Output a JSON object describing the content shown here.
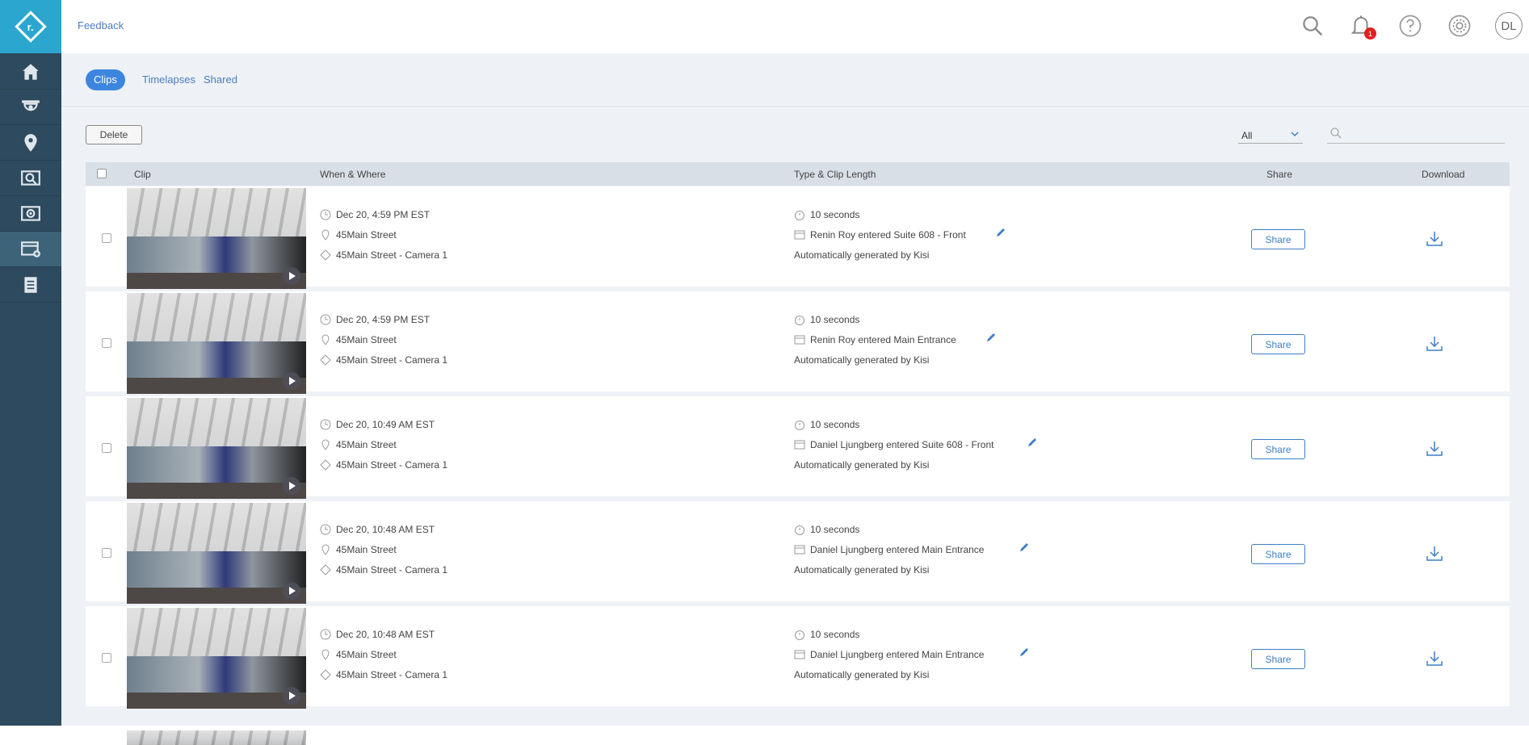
{
  "app": {
    "logo_letter": "r.",
    "feedback_label": "Feedback",
    "notification_count": "1",
    "avatar_initials": "DL"
  },
  "sidebar": {
    "items": [
      {
        "name": "home-icon"
      },
      {
        "name": "camera-icon"
      },
      {
        "name": "location-pin-icon"
      },
      {
        "name": "search-video-icon"
      },
      {
        "name": "video-wall-icon"
      },
      {
        "name": "clips-icon",
        "active": true
      },
      {
        "name": "reports-icon"
      }
    ]
  },
  "tabs": [
    {
      "label": "Clips",
      "active": true
    },
    {
      "label": "Timelapses"
    },
    {
      "label": "Shared"
    }
  ],
  "toolbar": {
    "delete_label": "Delete",
    "filter_value": "All",
    "search_placeholder": ""
  },
  "table": {
    "headers": {
      "clip": "Clip",
      "when_where": "When & Where",
      "type_length": "Type & Clip Length",
      "share": "Share",
      "download": "Download"
    },
    "share_label": "Share",
    "rows": [
      {
        "datetime": "Dec 20, 4:59 PM EST",
        "location": "45Main Street",
        "camera": "45Main Street - Camera 1",
        "length": "10 seconds",
        "event": "Renin Roy entered Suite 608 - Front",
        "generated": "Automatically generated by Kisi"
      },
      {
        "datetime": "Dec 20, 4:59 PM EST",
        "location": "45Main Street",
        "camera": "45Main Street - Camera 1",
        "length": "10 seconds",
        "event": "Renin Roy entered Main Entrance",
        "generated": "Automatically generated by Kisi"
      },
      {
        "datetime": "Dec 20, 10:49 AM EST",
        "location": "45Main Street",
        "camera": "45Main Street - Camera 1",
        "length": "10 seconds",
        "event": "Daniel Ljungberg entered Suite 608 - Front",
        "generated": "Automatically generated by Kisi"
      },
      {
        "datetime": "Dec 20, 10:48 AM EST",
        "location": "45Main Street",
        "camera": "45Main Street - Camera 1",
        "length": "10 seconds",
        "event": "Daniel Ljungberg entered Main Entrance",
        "generated": "Automatically generated by Kisi"
      },
      {
        "datetime": "Dec 20, 10:48 AM EST",
        "location": "45Main Street",
        "camera": "45Main Street - Camera 1",
        "length": "10 seconds",
        "event": "Daniel Ljungberg entered Main Entrance",
        "generated": "Automatically generated by Kisi"
      }
    ]
  },
  "colors": {
    "sidebar_bg": "#2e4a5f",
    "logo_bg": "#2aa6cf",
    "accent": "#3d86e0",
    "badge": "#e02020"
  }
}
